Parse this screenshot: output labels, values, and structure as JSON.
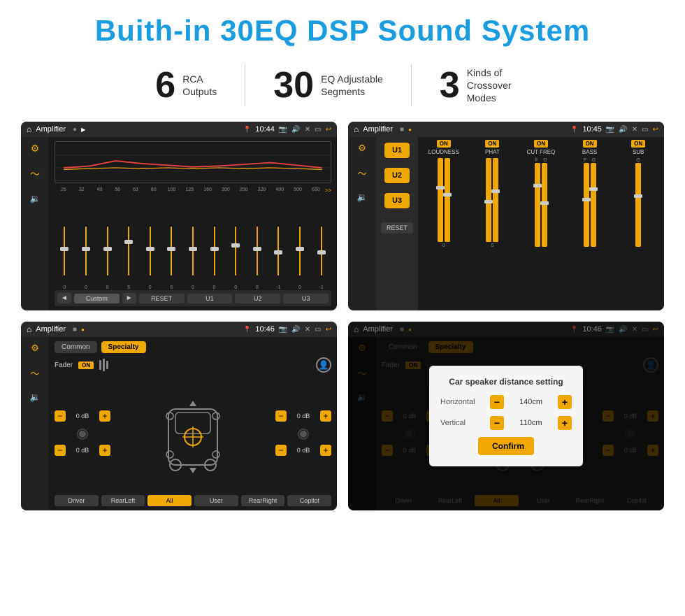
{
  "header": {
    "title": "Buith-in 30EQ DSP Sound System"
  },
  "stats": [
    {
      "number": "6",
      "text": "RCA\nOutputs"
    },
    {
      "number": "30",
      "text": "EQ Adjustable\nSegments"
    },
    {
      "number": "3",
      "text": "Kinds of\nCrossover Modes"
    }
  ],
  "screens": {
    "eq": {
      "title": "Amplifier",
      "time": "10:44",
      "labels": [
        "25",
        "32",
        "40",
        "50",
        "63",
        "80",
        "100",
        "125",
        "160",
        "200",
        "250",
        "320",
        "400",
        "500",
        "630"
      ],
      "values": [
        "0",
        "0",
        "0",
        "5",
        "0",
        "0",
        "0",
        "0",
        "0",
        "0",
        "-1",
        "0",
        "-1"
      ],
      "buttons": [
        "◄",
        "Custom",
        "►",
        "RESET",
        "U1",
        "U2",
        "U3"
      ]
    },
    "crossover": {
      "title": "Amplifier",
      "time": "10:45",
      "channels": [
        "U1",
        "U2",
        "U3"
      ],
      "cols": [
        {
          "on": true,
          "label": "LOUDNESS"
        },
        {
          "on": true,
          "label": "PHAT"
        },
        {
          "on": true,
          "label": "CUT FREQ"
        },
        {
          "on": true,
          "label": "BASS"
        },
        {
          "on": true,
          "label": "SUB"
        }
      ],
      "reset": "RESET"
    },
    "speaker": {
      "title": "Amplifier",
      "time": "10:46",
      "tabs": [
        "Common",
        "Specialty"
      ],
      "fader": "Fader",
      "faderOn": "ON",
      "volumes": [
        "0 dB",
        "0 dB",
        "0 dB",
        "0 dB"
      ],
      "buttons": [
        "Driver",
        "RearLeft",
        "All",
        "User",
        "RearRight",
        "Copilot"
      ]
    },
    "dialog": {
      "title": "Amplifier",
      "time": "10:46",
      "tabs": [
        "Common",
        "Specialty"
      ],
      "dialogTitle": "Car speaker distance setting",
      "horizontal": {
        "label": "Horizontal",
        "value": "140cm"
      },
      "vertical": {
        "label": "Vertical",
        "value": "110cm"
      },
      "confirm": "Confirm",
      "volumes": [
        "0 dB",
        "0 dB"
      ],
      "buttons": [
        "Driver",
        "RearLeft",
        "All",
        "User",
        "RearRight",
        "Copilot"
      ]
    }
  }
}
